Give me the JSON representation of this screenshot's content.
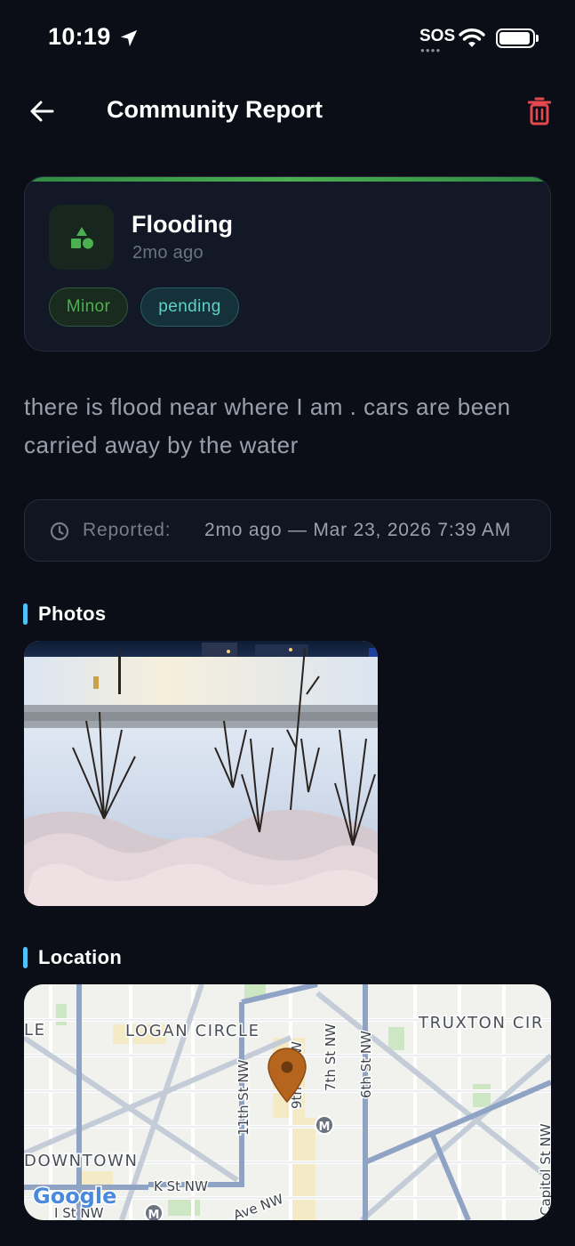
{
  "status_bar": {
    "time": "10:19",
    "sos": "SOS",
    "icons": [
      "location-arrow-icon",
      "wifi-icon",
      "battery-icon"
    ]
  },
  "header": {
    "title": "Community Report",
    "back_icon": "arrow-left-icon",
    "delete_icon": "trash-icon"
  },
  "report": {
    "type": "Flooding",
    "time_ago": "2mo ago",
    "type_icon": "shapes-icon",
    "severity": "Minor",
    "status": "pending",
    "accent_color": "#4caf50",
    "description": "there is flood near where I am . cars are been carried away by the water"
  },
  "reported": {
    "label": "Reported:",
    "value": "2mo ago — Mar 23, 2026 7:39 AM"
  },
  "photos": {
    "title": "Photos"
  },
  "location": {
    "title": "Location",
    "map_labels": {
      "logan_circle": "LOGAN CIRCLE",
      "truxton": "TRUXTON CIR",
      "downtown": "DOWNTOWN",
      "le": "LE",
      "st_11th": "11th St NW",
      "st_9th": "9th St NW",
      "st_7th": "7th St NW",
      "st_6th": "6th St NW",
      "k_st": "K St NW",
      "i_st": "I St NW",
      "ave_nw": "Ave NW",
      "capitol": "Capitol St NW",
      "google": "Google",
      "metro": "M"
    }
  }
}
